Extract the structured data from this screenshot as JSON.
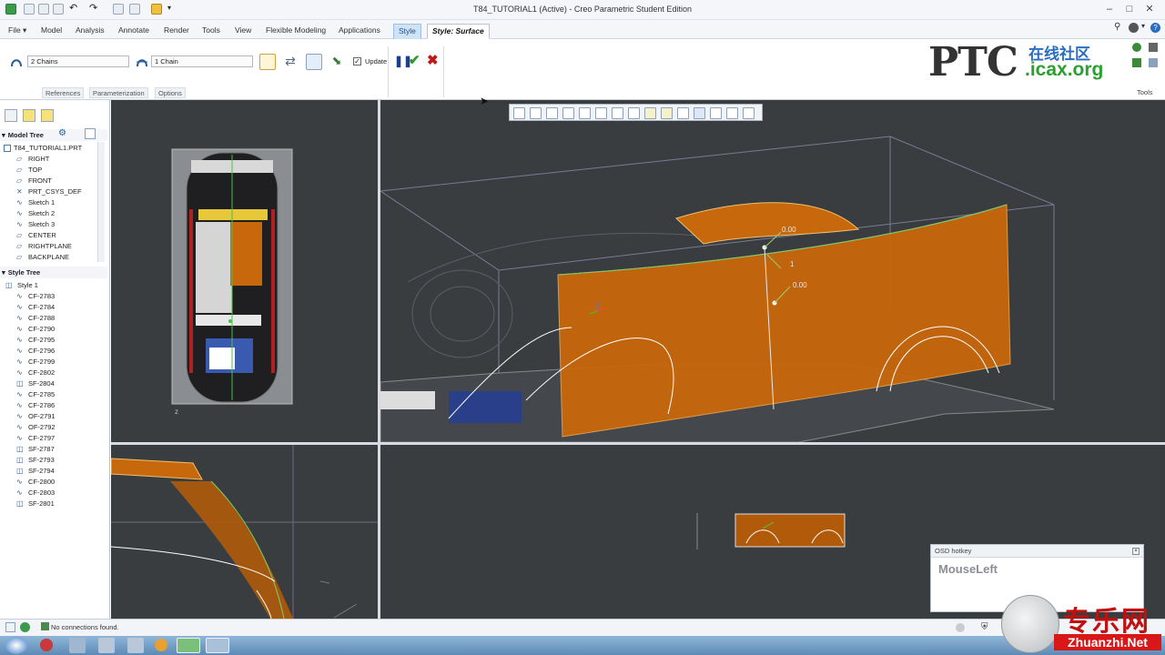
{
  "window": {
    "title": "T84_TUTORIAL1 (Active) - Creo Parametric Student Edition"
  },
  "tabs": [
    {
      "label": "File ▾"
    },
    {
      "label": "Model"
    },
    {
      "label": "Analysis"
    },
    {
      "label": "Annotate"
    },
    {
      "label": "Render"
    },
    {
      "label": "Tools"
    },
    {
      "label": "View"
    },
    {
      "label": "Flexible Modeling"
    },
    {
      "label": "Applications"
    },
    {
      "label": "Style"
    },
    {
      "label": "Style: Surface"
    }
  ],
  "ribbon": {
    "chains_primary": "2 Chains",
    "chains_cross": "1 Chain",
    "update_label": "Update",
    "update_checked": true,
    "subtabs": [
      "References",
      "Parameterization",
      "Options"
    ],
    "tools_label": "Tools"
  },
  "logo": {
    "brand": "PTC",
    "cn": "在线社区",
    "site": ".icax.org"
  },
  "model_tree": {
    "header": "Model Tree",
    "items": [
      "T84_TUTORIAL1.PRT",
      "RIGHT",
      "TOP",
      "FRONT",
      "PRT_CSYS_DEF",
      "Sketch 1",
      "Sketch 2",
      "Sketch 3",
      "CENTER",
      "RIGHTPLANE",
      "BACKPLANE"
    ]
  },
  "style_tree": {
    "header": "Style Tree",
    "items": [
      "Style 1",
      "CF-2783",
      "CF-2784",
      "CF-2788",
      "CF-2790",
      "CF-2795",
      "CF-2796",
      "CF-2799",
      "CF-2802",
      "SF-2804",
      "CF-2785",
      "CF-2786",
      "OF-2791",
      "OF-2792",
      "CF-2797",
      "SF-2787",
      "SF-2793",
      "SF-2794",
      "CF-2800",
      "CF-2803",
      "SF-2801"
    ]
  },
  "viewport": {
    "dim1": "0.00",
    "dim2": "1",
    "dim3": "0.00",
    "axis_z": "z"
  },
  "osd": {
    "title": "OSD hotkey",
    "value": "MouseLeft"
  },
  "status": {
    "message": "No connections found."
  },
  "watermark": {
    "cn": "专乐网",
    "site": "Zhuanzhi.Net"
  },
  "colors": {
    "surface": "#c8680c",
    "viewport_bg": "#3a3d40",
    "accent": "#2a5c9c"
  }
}
